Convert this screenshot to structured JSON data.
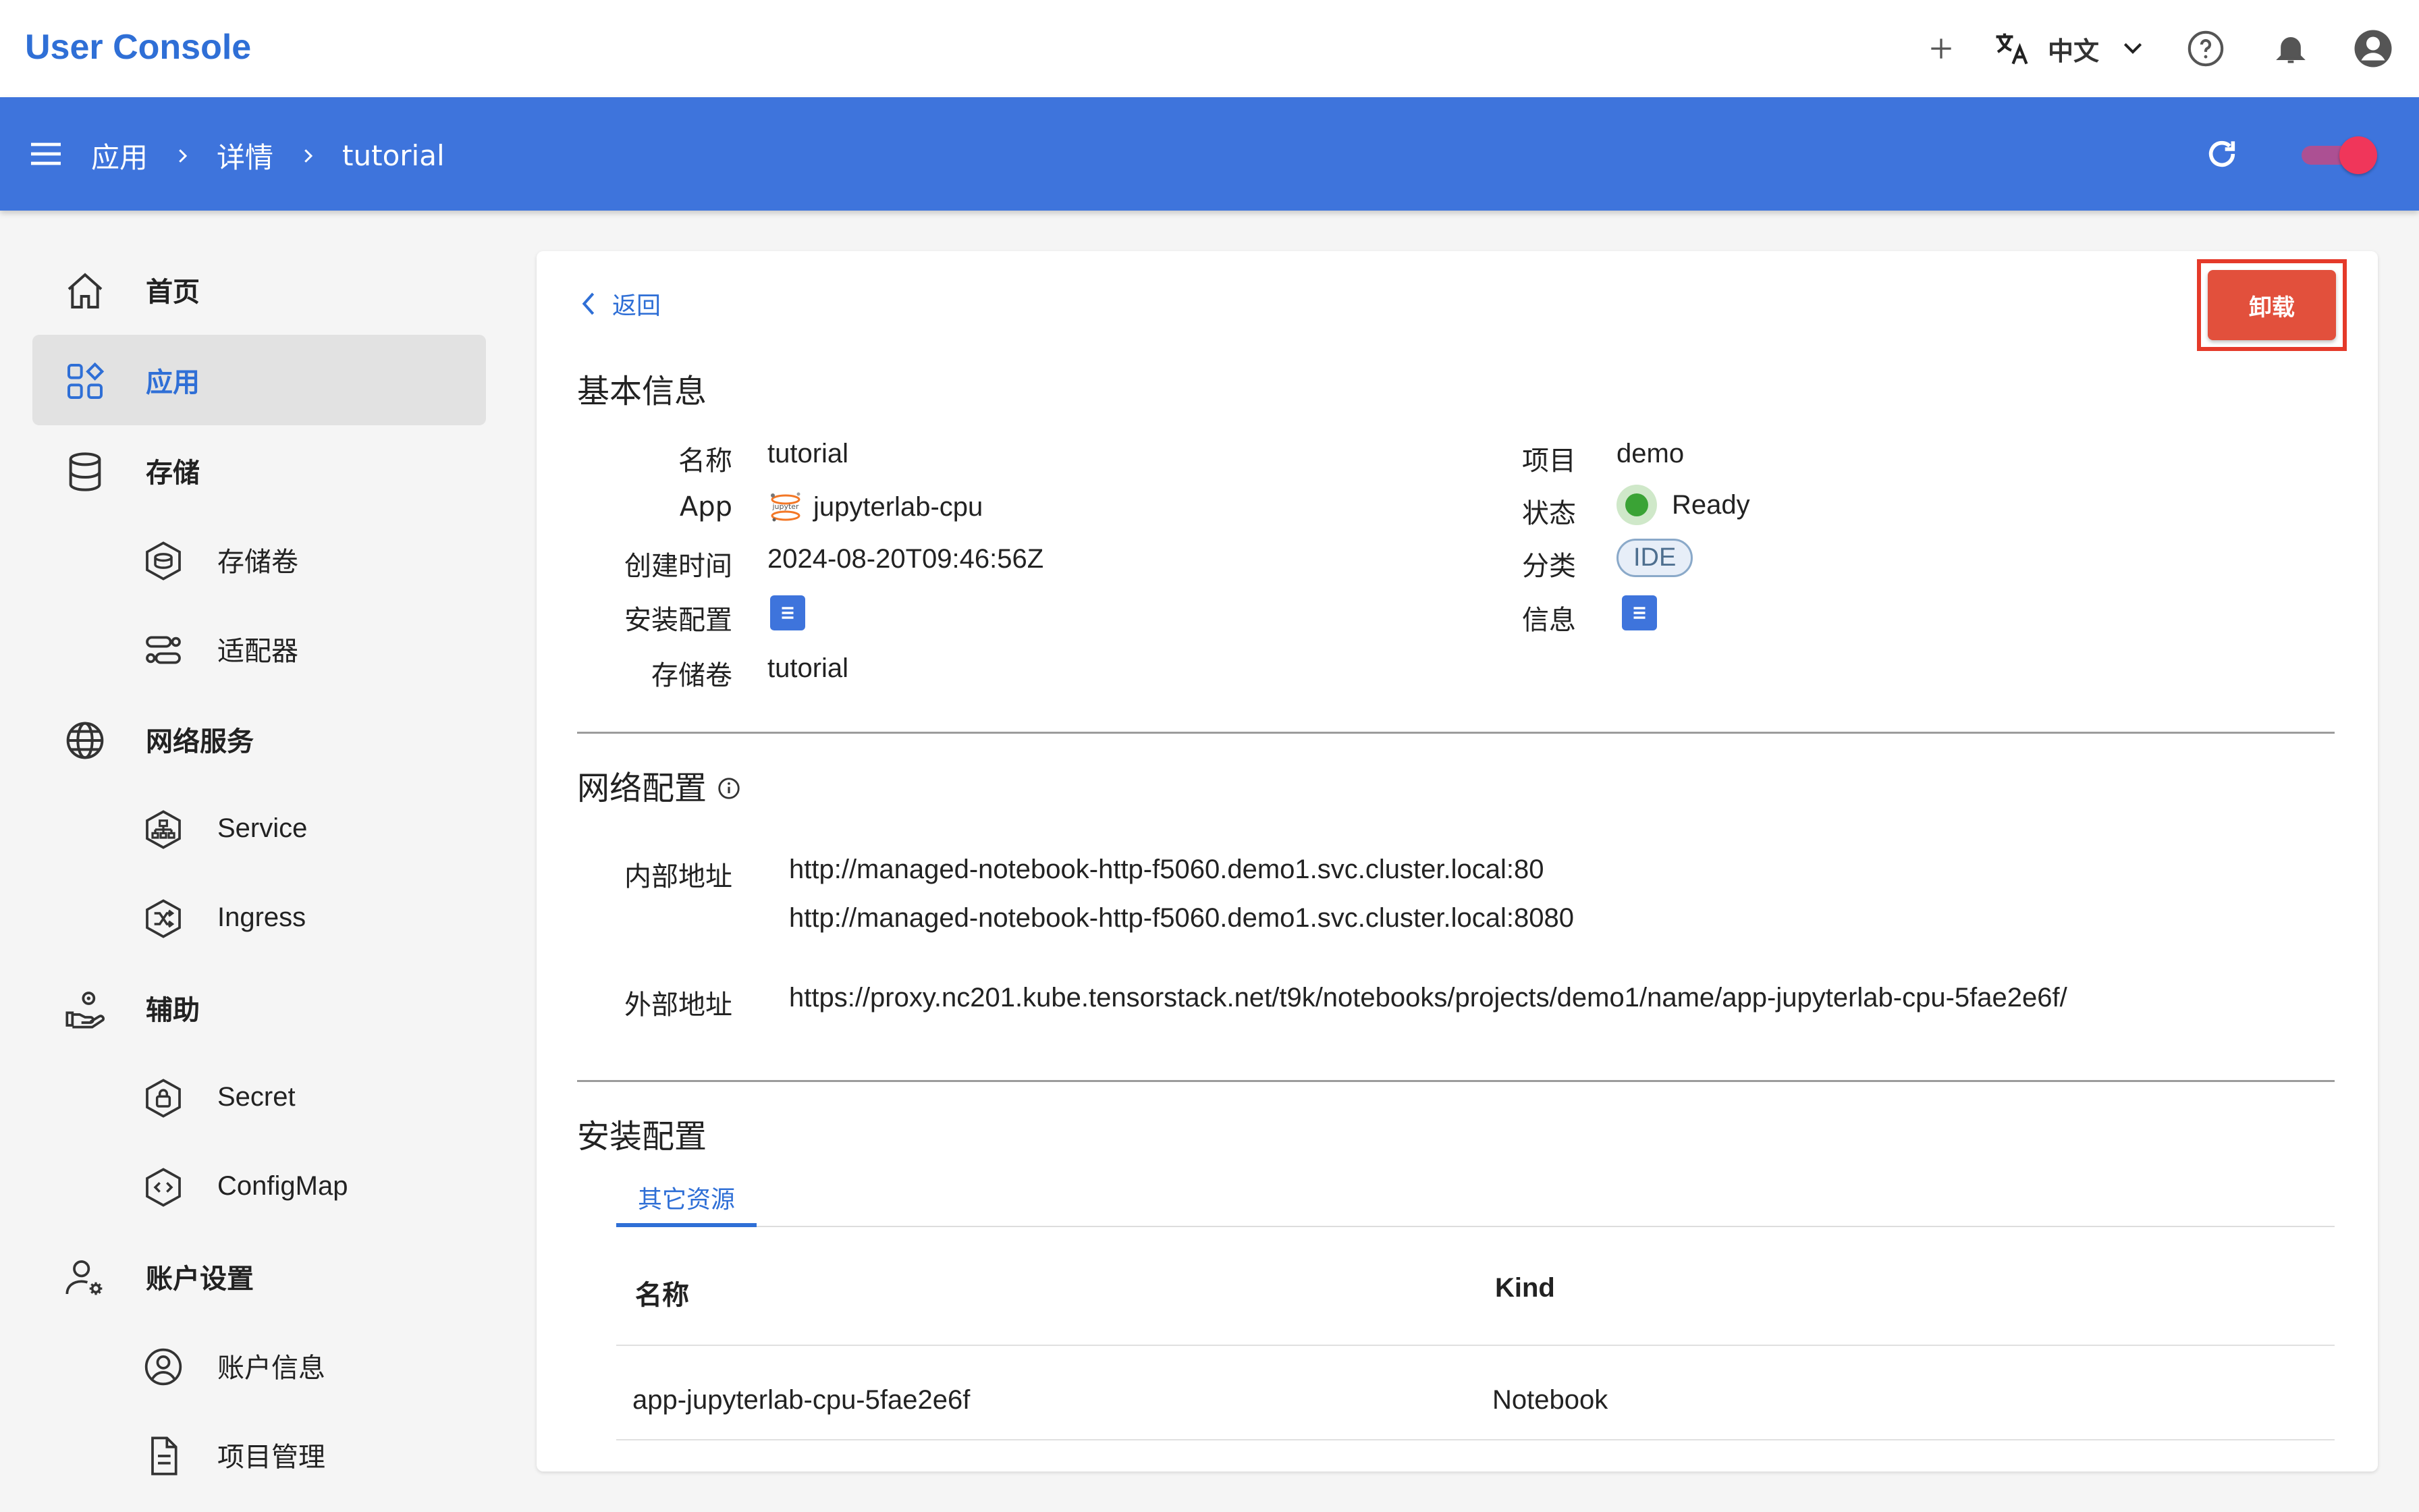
{
  "app_title": "User Console",
  "header": {
    "add_icon": "plus-icon",
    "translate_icon": "translate-icon",
    "language": "中文",
    "help_icon": "help-icon",
    "bell_icon": "bell-icon",
    "account_icon": "account-icon"
  },
  "breadcrumbs": [
    "应用",
    "详情",
    "tutorial"
  ],
  "sidebar": {
    "items": [
      {
        "label": "首页",
        "icon": "home-icon"
      },
      {
        "label": "应用",
        "icon": "apps-icon",
        "active": true
      },
      {
        "label": "存储",
        "icon": "database-icon"
      },
      {
        "label": "存储卷",
        "icon": "volume-icon"
      },
      {
        "label": "适配器",
        "icon": "adapter-icon"
      },
      {
        "label": "网络服务",
        "icon": "globe-icon"
      },
      {
        "label": "Service",
        "icon": "service-icon"
      },
      {
        "label": "Ingress",
        "icon": "ingress-icon"
      },
      {
        "label": "辅助",
        "icon": "helper-icon"
      },
      {
        "label": "Secret",
        "icon": "secret-icon"
      },
      {
        "label": "ConfigMap",
        "icon": "configmap-icon"
      },
      {
        "label": "账户设置",
        "icon": "user-settings-icon"
      },
      {
        "label": "账户信息",
        "icon": "account-info-icon"
      },
      {
        "label": "项目管理",
        "icon": "document-icon"
      }
    ]
  },
  "detail": {
    "back_label": "返回",
    "uninstall_label": "卸载",
    "basic_title": "基本信息",
    "basic_left": [
      {
        "label": "名称",
        "value": "tutorial"
      },
      {
        "label": "App",
        "value": "jupyterlab-cpu"
      },
      {
        "label": "创建时间",
        "value": "2024-08-20T09:46:56Z"
      },
      {
        "label": "安装配置",
        "value": ""
      },
      {
        "label": "存储卷",
        "value": "tutorial"
      }
    ],
    "basic_right": [
      {
        "label": "项目",
        "value": "demo"
      },
      {
        "label": "状态",
        "value": "Ready"
      },
      {
        "label": "分类",
        "value": "IDE"
      },
      {
        "label": "信息",
        "value": ""
      }
    ],
    "jupyter_logo_text": "jupyter",
    "status_color": "#3aa335",
    "network_title": "网络配置",
    "internal_label": "内部地址",
    "internal_urls": [
      "http://managed-notebook-http-f5060.demo1.svc.cluster.local:80",
      "http://managed-notebook-http-f5060.demo1.svc.cluster.local:8080"
    ],
    "external_label": "外部地址",
    "external_url": "https://proxy.nc201.kube.tensorstack.net/t9k/notebooks/projects/demo1/name/app-jupyterlab-cpu-5fae2e6f/",
    "install_title": "安装配置",
    "tab_label": "其它资源",
    "table": {
      "headers": [
        "名称",
        "Kind"
      ],
      "rows": [
        [
          "app-jupyterlab-cpu-5fae2e6f",
          "Notebook"
        ]
      ]
    }
  },
  "colors": {
    "brand_blue": "#3e74dc",
    "title_blue": "#2f6fd6",
    "danger": "#e2503c"
  }
}
